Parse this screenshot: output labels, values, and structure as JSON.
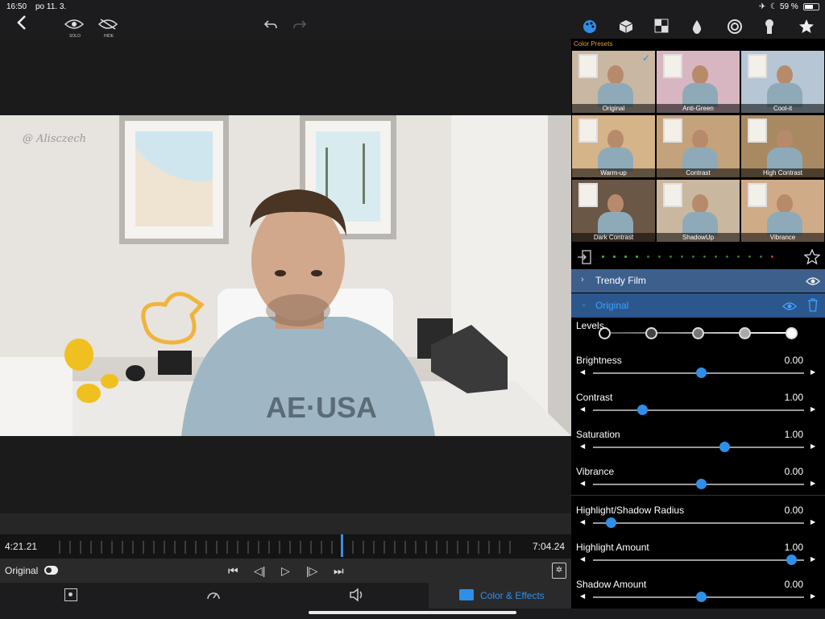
{
  "status": {
    "time": "16:50",
    "date": "po 11. 3.",
    "battery": "59 %"
  },
  "toolbar": {
    "back_icon": "chevron-left-icon",
    "solo_label": "SOLO",
    "hide_label": "HIDE",
    "tools": [
      "palette-icon",
      "cube-icon",
      "pattern-icon",
      "drop-icon",
      "spiral-icon",
      "keyhole-icon",
      "star-icon"
    ]
  },
  "video": {
    "watermark": "@ Alisczech"
  },
  "timeline": {
    "current": "4:21.21",
    "total": "7:04.24"
  },
  "transport": {
    "preset_name": "Original"
  },
  "tabs": {
    "active_label": "Color & Effects"
  },
  "panel": {
    "presets_title": "Color Presets",
    "presets": [
      {
        "name": "Original",
        "tint": "#c9b7a2",
        "selected": true
      },
      {
        "name": "Anti-Green",
        "tint": "#d8b6c1"
      },
      {
        "name": "Cool-it",
        "tint": "#b6c6d4"
      },
      {
        "name": "Warm-up",
        "tint": "#d6b48a"
      },
      {
        "name": "Contrast",
        "tint": "#c4a27c"
      },
      {
        "name": "High Contrast",
        "tint": "#a98962"
      },
      {
        "name": "Dark Contrast",
        "tint": "#6a5746"
      },
      {
        "name": "ShadowUp",
        "tint": "#cab7a0"
      },
      {
        "name": "Vibrance",
        "tint": "#d0ab88"
      }
    ],
    "trendy_label": "Trendy Film",
    "original_label": "Original",
    "levels_label": "Levels",
    "sliders": [
      {
        "label": "Brightness",
        "value": "0.00"
      },
      {
        "label": "Contrast",
        "value": "1.00"
      },
      {
        "label": "Saturation",
        "value": "1.00"
      },
      {
        "label": "Vibrance",
        "value": "0.00"
      },
      {
        "label": "Highlight/Shadow Radius",
        "value": "0.00"
      },
      {
        "label": "Highlight Amount",
        "value": "1.00"
      },
      {
        "label": "Shadow Amount",
        "value": "0.00"
      }
    ]
  },
  "colors": {
    "accent": "#2f8fe8",
    "preset_label": "#e0a02a",
    "row_trendy": "#3d5f8c",
    "row_original": "#2b578d"
  }
}
